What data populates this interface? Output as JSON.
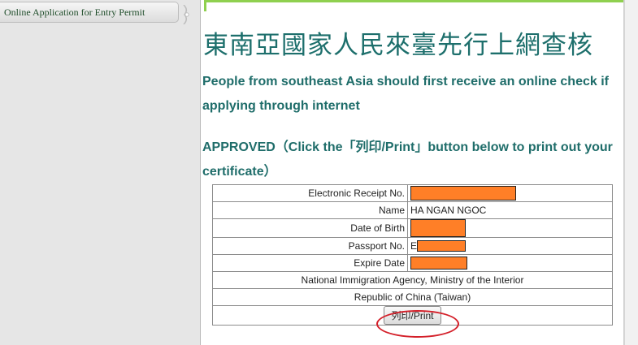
{
  "sidebar": {
    "tab_label": "Online  Application  for  Entry  Permit"
  },
  "main": {
    "title_cn": "東南亞國家人民來臺先行上網查核",
    "subtitle": "People from southeast Asia should first receive an online check if applying through internet",
    "status": "APPROVED（Click the「列印/Print」button below to print out your certificate）"
  },
  "receipt": {
    "rows": [
      {
        "label": "Electronic Receipt No.",
        "value": ""
      },
      {
        "label": "Name",
        "value": "HA NGAN NGOC"
      },
      {
        "label": "Date of Birth",
        "value": ""
      },
      {
        "label": "Passport No.",
        "value": "E"
      },
      {
        "label": "Expire Date",
        "value": ""
      }
    ],
    "agency": "National Immigration Agency, Ministry of the Interior",
    "country": "Republic of China (Taiwan)",
    "print_label": "列印/Print"
  },
  "colors": {
    "title": "#1d6f6c",
    "redaction": "#ff7f27",
    "accent_line": "#8fd04f",
    "circle": "#d4202a"
  },
  "icons": {
    "sidebar_knob": "tab-knob-icon"
  }
}
